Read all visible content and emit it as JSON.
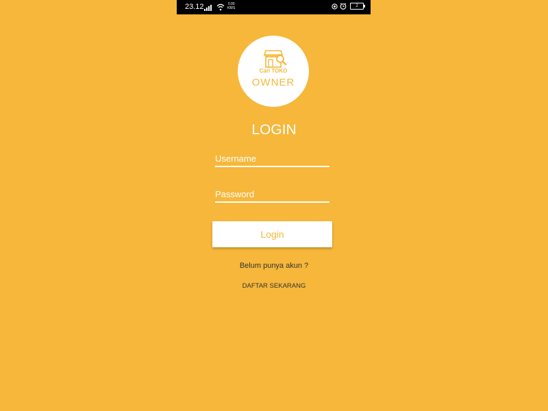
{
  "status_bar": {
    "time": "23.12",
    "net_speed_value": "0.00",
    "net_speed_unit": "KB/S",
    "battery": "2",
    "icons": [
      "signal-icon",
      "wifi-icon",
      "status-circle-icon",
      "alarm-icon",
      "battery-icon"
    ]
  },
  "logo": {
    "brand": "Cari TOKO",
    "subtitle": "OWNER",
    "icon": "store-icon"
  },
  "login": {
    "title": "LOGIN",
    "username_placeholder": "Username",
    "username_value": "",
    "password_placeholder": "Password",
    "password_value": "",
    "button_label": "Login"
  },
  "register": {
    "question": "Belum punya akun ?",
    "link_label": "DAFTAR SEKARANG"
  },
  "colors": {
    "background": "#f6b73a",
    "accent": "#f6b73a",
    "white": "#ffffff",
    "text_dark": "#333333"
  }
}
